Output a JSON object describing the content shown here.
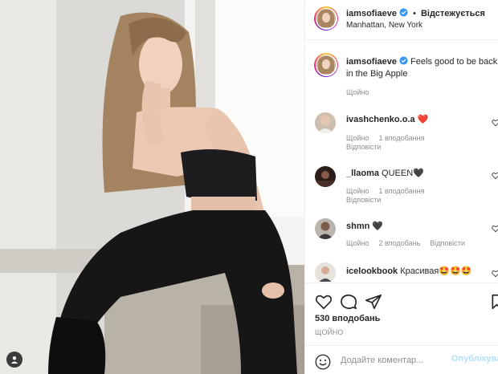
{
  "header": {
    "username": "iamsofiaeve",
    "separator": "•",
    "follow_label": "Відстежується",
    "location": "Manhattan, New York"
  },
  "caption": {
    "username": "iamsofiaeve",
    "text": "Feels good to be back in the Big Apple",
    "time": "Щойно"
  },
  "comments": [
    {
      "username": "ivashchenko.o.a",
      "text": "❤️",
      "time": "Щойно",
      "likes": "1 вподобання",
      "reply": "Відповісти"
    },
    {
      "username": "_llaoma",
      "text": "QUEEN🖤",
      "time": "Щойно",
      "likes": "1 вподобання",
      "reply": "Відповісти"
    },
    {
      "username": "shmn",
      "text": "🖤",
      "time": "Щойно",
      "likes": "2 вподобань",
      "reply": "Відповісти"
    },
    {
      "username": "icelookbook",
      "text": "Красивая🤩🤩🤩"
    }
  ],
  "actions": {
    "like_icon": "heart-icon",
    "comment_icon": "comment-icon",
    "share_icon": "share-icon",
    "save_icon": "bookmark-icon"
  },
  "likes": "530 вподобань",
  "post_time": "ЩОЙНО",
  "add_comment": {
    "placeholder": "Додайте коментар...",
    "publish_label": "Опублікувати"
  },
  "colors": {
    "verified": "#3897f0",
    "link_disabled": "#b2dffc",
    "muted": "#8e8e8e",
    "heart_red": "#ed4956"
  }
}
